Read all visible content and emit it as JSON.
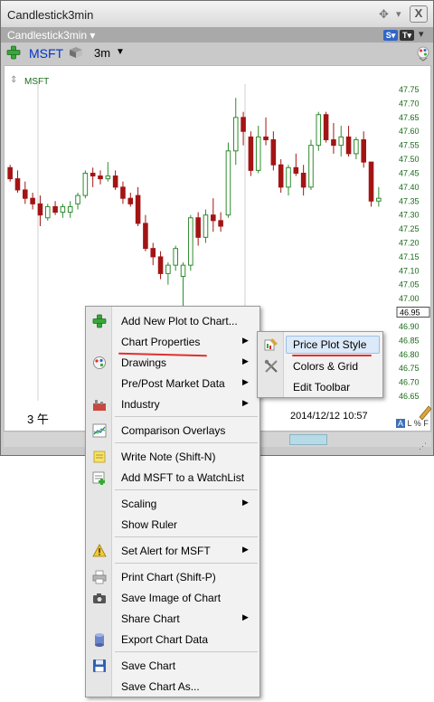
{
  "window": {
    "title": "Candlestick3min",
    "sub_title": "Candlestick3min",
    "sub_title_caret": "▾",
    "move_icon": "✥",
    "caret_icon": "▾",
    "close_label": "X",
    "s_badge": "S▾",
    "t_badge": "T▾"
  },
  "toolbar": {
    "symbol": "MSFT",
    "interval": "3m",
    "interval_caret": "▼"
  },
  "chart": {
    "series_label": "MSFT",
    "x_left_label": "3 午",
    "x_right_label": "2014/12/12 10:57",
    "scale_options": [
      "A",
      "L",
      "%",
      "F"
    ]
  },
  "chart_data": {
    "type": "candlestick",
    "symbol": "MSFT",
    "interval": "3m",
    "y_ticks": [
      "47.75",
      "47.70",
      "47.65",
      "47.60",
      "47.55",
      "47.50",
      "47.45",
      "47.40",
      "47.35",
      "47.30",
      "47.25",
      "47.20",
      "47.15",
      "47.10",
      "47.05",
      "47.00",
      "46.95",
      "46.90",
      "46.85",
      "46.80",
      "46.75",
      "46.70",
      "46.65"
    ],
    "last_price_label": "46.95",
    "ylim": [
      46.65,
      47.75
    ],
    "candles": [
      {
        "o": 47.47,
        "h": 47.48,
        "l": 47.42,
        "c": 47.43
      },
      {
        "o": 47.43,
        "h": 47.46,
        "l": 47.38,
        "c": 47.39
      },
      {
        "o": 47.39,
        "h": 47.42,
        "l": 47.34,
        "c": 47.36
      },
      {
        "o": 47.36,
        "h": 47.38,
        "l": 47.32,
        "c": 47.34
      },
      {
        "o": 47.34,
        "h": 47.37,
        "l": 47.26,
        "c": 47.3
      },
      {
        "o": 47.29,
        "h": 47.34,
        "l": 47.28,
        "c": 47.33
      },
      {
        "o": 47.33,
        "h": 47.35,
        "l": 47.3,
        "c": 47.31
      },
      {
        "o": 47.31,
        "h": 47.34,
        "l": 47.29,
        "c": 47.33
      },
      {
        "o": 47.31,
        "h": 47.35,
        "l": 47.29,
        "c": 47.33
      },
      {
        "o": 47.34,
        "h": 47.38,
        "l": 47.32,
        "c": 47.37
      },
      {
        "o": 47.37,
        "h": 47.46,
        "l": 47.36,
        "c": 47.45
      },
      {
        "o": 47.45,
        "h": 47.47,
        "l": 47.4,
        "c": 47.44
      },
      {
        "o": 47.44,
        "h": 47.46,
        "l": 47.41,
        "c": 47.43
      },
      {
        "o": 47.43,
        "h": 47.49,
        "l": 47.42,
        "c": 47.44
      },
      {
        "o": 47.44,
        "h": 47.46,
        "l": 47.39,
        "c": 47.4
      },
      {
        "o": 47.4,
        "h": 47.42,
        "l": 47.34,
        "c": 47.36
      },
      {
        "o": 47.36,
        "h": 47.38,
        "l": 47.33,
        "c": 47.34
      },
      {
        "o": 47.37,
        "h": 47.4,
        "l": 47.26,
        "c": 47.27
      },
      {
        "o": 47.27,
        "h": 47.3,
        "l": 47.17,
        "c": 47.18
      },
      {
        "o": 47.18,
        "h": 47.2,
        "l": 47.12,
        "c": 47.15
      },
      {
        "o": 47.15,
        "h": 47.17,
        "l": 47.07,
        "c": 47.09
      },
      {
        "o": 47.09,
        "h": 47.13,
        "l": 47.05,
        "c": 47.12
      },
      {
        "o": 47.12,
        "h": 47.19,
        "l": 47.1,
        "c": 47.18
      },
      {
        "o": 47.08,
        "h": 47.13,
        "l": 46.95,
        "c": 47.12
      },
      {
        "o": 47.12,
        "h": 47.3,
        "l": 47.1,
        "c": 47.29
      },
      {
        "o": 47.29,
        "h": 47.31,
        "l": 47.19,
        "c": 47.22
      },
      {
        "o": 47.22,
        "h": 47.32,
        "l": 47.2,
        "c": 47.3
      },
      {
        "o": 47.3,
        "h": 47.36,
        "l": 47.24,
        "c": 47.28
      },
      {
        "o": 47.28,
        "h": 47.31,
        "l": 47.24,
        "c": 47.26
      },
      {
        "o": 47.3,
        "h": 47.56,
        "l": 47.29,
        "c": 47.53
      },
      {
        "o": 47.53,
        "h": 47.72,
        "l": 47.48,
        "c": 47.65
      },
      {
        "o": 47.65,
        "h": 47.67,
        "l": 47.55,
        "c": 47.6
      },
      {
        "o": 47.58,
        "h": 47.6,
        "l": 47.44,
        "c": 47.46
      },
      {
        "o": 47.46,
        "h": 47.62,
        "l": 47.45,
        "c": 47.58
      },
      {
        "o": 47.58,
        "h": 47.65,
        "l": 47.55,
        "c": 47.57
      },
      {
        "o": 47.57,
        "h": 47.6,
        "l": 47.46,
        "c": 47.48
      },
      {
        "o": 47.48,
        "h": 47.5,
        "l": 47.38,
        "c": 47.4
      },
      {
        "o": 47.4,
        "h": 47.48,
        "l": 47.37,
        "c": 47.47
      },
      {
        "o": 47.47,
        "h": 47.52,
        "l": 47.44,
        "c": 47.45
      },
      {
        "o": 47.45,
        "h": 47.48,
        "l": 47.37,
        "c": 47.4
      },
      {
        "o": 47.4,
        "h": 47.57,
        "l": 47.39,
        "c": 47.55
      },
      {
        "o": 47.55,
        "h": 47.67,
        "l": 47.53,
        "c": 47.66
      },
      {
        "o": 47.66,
        "h": 47.67,
        "l": 47.56,
        "c": 47.57
      },
      {
        "o": 47.57,
        "h": 47.63,
        "l": 47.52,
        "c": 47.55
      },
      {
        "o": 47.55,
        "h": 47.62,
        "l": 47.51,
        "c": 47.58
      },
      {
        "o": 47.58,
        "h": 47.62,
        "l": 47.51,
        "c": 47.52
      },
      {
        "o": 47.52,
        "h": 47.58,
        "l": 47.5,
        "c": 47.57
      },
      {
        "o": 47.57,
        "h": 47.6,
        "l": 47.47,
        "c": 47.49
      },
      {
        "o": 47.49,
        "h": 47.49,
        "l": 47.33,
        "c": 47.35
      },
      {
        "o": 47.35,
        "h": 47.4,
        "l": 47.33,
        "c": 47.36
      }
    ]
  },
  "context_menu": {
    "items": [
      {
        "label": "Add New Plot to Chart...",
        "icon": "plus-icon",
        "arrow": false
      },
      {
        "label": "Chart Properties",
        "icon": "",
        "arrow": true
      },
      {
        "label": "Drawings",
        "icon": "palette-icon",
        "arrow": true
      },
      {
        "label": "Pre/Post Market Data",
        "icon": "",
        "arrow": true
      },
      {
        "label": "Industry",
        "icon": "industry-icon",
        "arrow": true
      },
      {
        "label": "Comparison Overlays",
        "icon": "overlay-chart-icon",
        "arrow": false
      },
      {
        "label": "Write Note (Shift-N)",
        "icon": "note-icon",
        "arrow": false
      },
      {
        "label": "Add MSFT to a WatchList",
        "icon": "watchlist-icon",
        "arrow": false
      },
      {
        "label": "Scaling",
        "icon": "",
        "arrow": true
      },
      {
        "label": "Show Ruler",
        "icon": "",
        "arrow": false
      },
      {
        "label": "Set Alert for MSFT",
        "icon": "warning-icon",
        "arrow": true
      },
      {
        "label": "Print Chart (Shift-P)",
        "icon": "printer-icon",
        "arrow": false
      },
      {
        "label": "Save Image of Chart",
        "icon": "camera-icon",
        "arrow": false
      },
      {
        "label": "Share Chart",
        "icon": "",
        "arrow": true
      },
      {
        "label": "Export Chart Data",
        "icon": "database-icon",
        "arrow": false
      },
      {
        "label": "Save Chart",
        "icon": "floppy-disk-icon",
        "arrow": false
      },
      {
        "label": "Save Chart As...",
        "icon": "",
        "arrow": false
      }
    ],
    "arrow_glyph": "▶"
  },
  "sub_menu": {
    "items": [
      {
        "label": "Price Plot Style",
        "icon": "style-brush-icon",
        "highlighted": true
      },
      {
        "label": "Colors & Grid",
        "icon": "tools-icon",
        "highlighted": false
      },
      {
        "label": "Edit Toolbar",
        "icon": "",
        "highlighted": false
      }
    ]
  },
  "colors": {
    "up_candle": "#2e8b2e",
    "down_candle": "#a31414",
    "axis_text": "#1a6b1a",
    "annotation_underline": "#e03030",
    "menu_highlight": "#dbe9f8"
  }
}
